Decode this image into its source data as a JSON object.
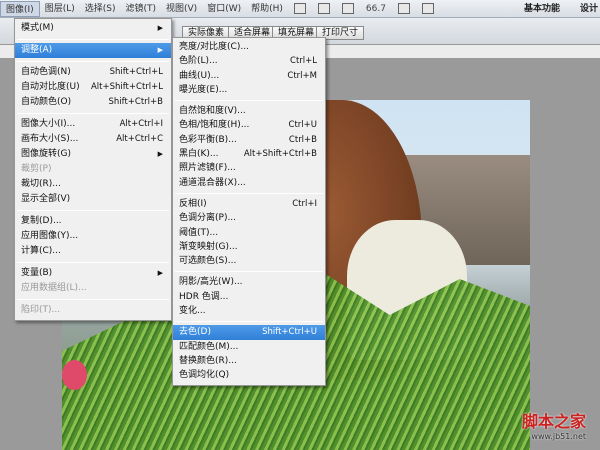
{
  "menubar": {
    "items": [
      "图像(I)",
      "图层(L)",
      "选择(S)",
      "滤镜(T)",
      "视图(V)",
      "窗口(W)",
      "帮助(H)"
    ],
    "zoom": "66.7",
    "workspace": "基本功能",
    "workspace2": "设计"
  },
  "options": {
    "buttons": [
      "实际像素",
      "适合屏幕",
      "填充屏幕",
      "打印尺寸"
    ]
  },
  "image_menu": [
    {
      "label": "模式(M)",
      "submenu": true
    },
    {
      "sep": true
    },
    {
      "label": "调整(A)",
      "submenu": true,
      "selected": true
    },
    {
      "sep": true
    },
    {
      "label": "自动色调(N)",
      "shortcut": "Shift+Ctrl+L"
    },
    {
      "label": "自动对比度(U)",
      "shortcut": "Alt+Shift+Ctrl+L"
    },
    {
      "label": "自动颜色(O)",
      "shortcut": "Shift+Ctrl+B"
    },
    {
      "sep": true
    },
    {
      "label": "图像大小(I)...",
      "shortcut": "Alt+Ctrl+I"
    },
    {
      "label": "画布大小(S)...",
      "shortcut": "Alt+Ctrl+C"
    },
    {
      "label": "图像旋转(G)",
      "submenu": true
    },
    {
      "label": "裁剪(P)",
      "disabled": true
    },
    {
      "label": "裁切(R)..."
    },
    {
      "label": "显示全部(V)"
    },
    {
      "sep": true
    },
    {
      "label": "复制(D)..."
    },
    {
      "label": "应用图像(Y)..."
    },
    {
      "label": "计算(C)..."
    },
    {
      "sep": true
    },
    {
      "label": "变量(B)",
      "submenu": true
    },
    {
      "label": "应用数据组(L)...",
      "disabled": true
    },
    {
      "sep": true
    },
    {
      "label": "陷印(T)...",
      "disabled": true
    }
  ],
  "adjust_menu": [
    {
      "label": "亮度/对比度(C)..."
    },
    {
      "label": "色阶(L)...",
      "shortcut": "Ctrl+L"
    },
    {
      "label": "曲线(U)...",
      "shortcut": "Ctrl+M"
    },
    {
      "label": "曝光度(E)..."
    },
    {
      "sep": true
    },
    {
      "label": "自然饱和度(V)..."
    },
    {
      "label": "色相/饱和度(H)...",
      "shortcut": "Ctrl+U"
    },
    {
      "label": "色彩平衡(B)...",
      "shortcut": "Ctrl+B"
    },
    {
      "label": "黑白(K)...",
      "shortcut": "Alt+Shift+Ctrl+B"
    },
    {
      "label": "照片滤镜(F)..."
    },
    {
      "label": "通道混合器(X)..."
    },
    {
      "sep": true
    },
    {
      "label": "反相(I)",
      "shortcut": "Ctrl+I"
    },
    {
      "label": "色调分离(P)..."
    },
    {
      "label": "阈值(T)..."
    },
    {
      "label": "渐变映射(G)..."
    },
    {
      "label": "可选颜色(S)..."
    },
    {
      "sep": true
    },
    {
      "label": "阴影/高光(W)..."
    },
    {
      "label": "HDR 色调..."
    },
    {
      "label": "变化..."
    },
    {
      "sep": true
    },
    {
      "label": "去色(D)",
      "shortcut": "Shift+Ctrl+U",
      "selected": true
    },
    {
      "label": "匹配颜色(M)..."
    },
    {
      "label": "替换颜色(R)..."
    },
    {
      "label": "色调均化(Q)"
    }
  ],
  "watermark": {
    "text": "脚本之家",
    "url": "www.jb51.net"
  },
  "colors": {
    "highlight": "#3a8ae0"
  }
}
